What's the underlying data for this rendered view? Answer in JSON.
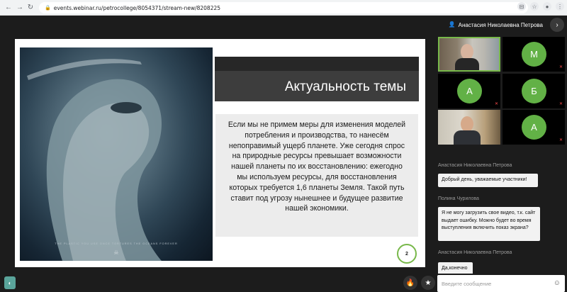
{
  "browser": {
    "url": "events.webinar.ru/petrocollege/8054371/stream-new/8208225",
    "back_icon": "arrow-left-icon",
    "forward_icon": "arrow-right-icon",
    "reload_icon": "reload-icon",
    "lock_icon": "lock-icon"
  },
  "header": {
    "user_name": "Анастасия Николаевна Петрова",
    "collapse_icon": "chevron-right-icon"
  },
  "slide": {
    "title": "Актуальность темы",
    "body": "Если мы не примем меры для изменения моделей потребления и производства, то нанесём непоправимый ущерб планете. Уже сегодня спрос на природные ресурсы превышает возможности нашей планеты по их восстановлению: ежегодно мы используем ресурсы, для восстановления которых требуется 1,6 планеты Земля. Такой путь ставит под угрозу нынешнее и будущее развитие нашей экономики.",
    "image_caption": "THE PLASTIC YOU USE ONCE TORTURES THE OCEANS FOREVER",
    "page_number": "2"
  },
  "participants": [
    {
      "type": "video",
      "active": true
    },
    {
      "type": "avatar",
      "initial": "М",
      "mic_off": true
    },
    {
      "type": "avatar",
      "initial": "А",
      "mic_off": true
    },
    {
      "type": "avatar",
      "initial": "Б",
      "mic_off": true
    },
    {
      "type": "video",
      "active": false
    },
    {
      "type": "avatar",
      "initial": "А",
      "mic_off": true
    }
  ],
  "chat": {
    "messages": [
      {
        "author": "Анастасия Николаевна Петрова",
        "text": "Добрый день, уважаемые участники!"
      },
      {
        "author": "Полина Чурилова",
        "text": "Я не могу загрузить свое видео, т.к. сайт выдает ошибку. Можно будет во время выступления включить показ экрана?"
      },
      {
        "author": "Анастасия Николаевна Петрова",
        "text": "Да,конечно"
      }
    ],
    "input_placeholder": "Введите сообщение"
  },
  "colors": {
    "accent": "#78b84a",
    "avatar_bg": "#62b146",
    "background": "#1c1c1c"
  }
}
